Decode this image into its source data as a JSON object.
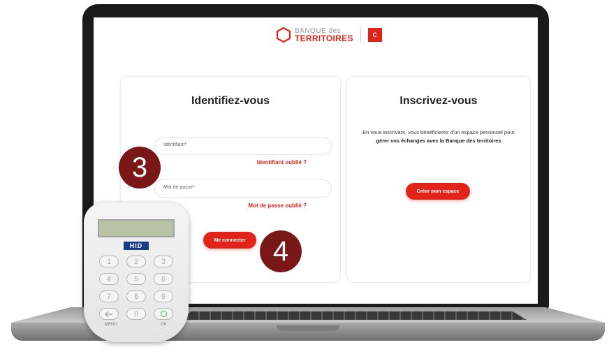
{
  "logo": {
    "line1": "BANQUE des",
    "line2": "TERRITOIRES",
    "badge": "C"
  },
  "login": {
    "title": "Identifiez-vous",
    "identifier_placeholder": "Identifiant*",
    "identifier_forgot": "Identifiant oublié ?",
    "password_placeholder": "Mot de passe*",
    "password_forgot": "Mot de passe oublié ?",
    "submit_label": "Me connecter"
  },
  "signup": {
    "title": "Inscrivez-vous",
    "desc_part1": "En vous inscrivant, vous bénéficierez d'un espace personnel pour ",
    "desc_bold": "gérer vos échanges avec la Banque des territoires",
    "button_label": "Créer mon espace"
  },
  "steps": {
    "three": "3",
    "four": "4"
  },
  "token": {
    "brand": "HID",
    "keys": [
      "1",
      "2",
      "3",
      "4",
      "5",
      "6",
      "7",
      "8",
      "9",
      "0"
    ],
    "menu_label": "MENU",
    "ok_label": "OK"
  },
  "colors": {
    "accent": "#e2231a",
    "step_badge": "#7a1818",
    "hid_blue": "#1b3a8a"
  }
}
